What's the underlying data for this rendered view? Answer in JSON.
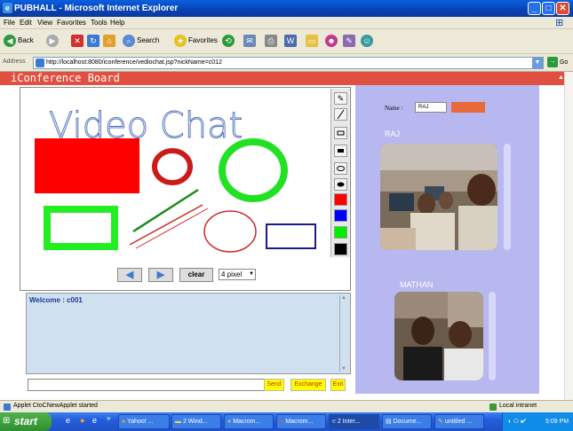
{
  "window": {
    "title": "PUBHALL - Microsoft Internet Explorer"
  },
  "menu": [
    "File",
    "Edit",
    "View",
    "Favorites",
    "Tools",
    "Help"
  ],
  "toolbar": {
    "back": "Back",
    "search": "Search",
    "favorites": "Favorites"
  },
  "address": {
    "label": "Address",
    "url": "http://localhost:8080/iconference/vediochat.jsp?nickName=c012",
    "go": "Go"
  },
  "board": {
    "header": "iConference Board",
    "canvas_text": "Video Chat"
  },
  "controls": {
    "clear": "clear",
    "pen_size": "4 pixel"
  },
  "chat": {
    "welcome": "Welcome : c001",
    "send": "Send",
    "exchange": "Exchange",
    "exit": "Exit"
  },
  "right": {
    "name_label": "Name :",
    "name_value": "RAJ",
    "user1": "RAJ",
    "user2": "MATHAN"
  },
  "status": {
    "left": "Applet CtoCNewApplet started",
    "zone": "Local intranet"
  },
  "taskbar": {
    "start": "start",
    "tasks": [
      "Yahoo! ...",
      "2 Wind...",
      "Macrom...",
      "Macrom...",
      "2 Inter...",
      "Docume...",
      "untitled ..."
    ],
    "clock": "5:09 PM"
  },
  "colors": {
    "accent": "#e05040",
    "panel": "#b8b8f0",
    "chat_bg": "#cfe0f0"
  }
}
